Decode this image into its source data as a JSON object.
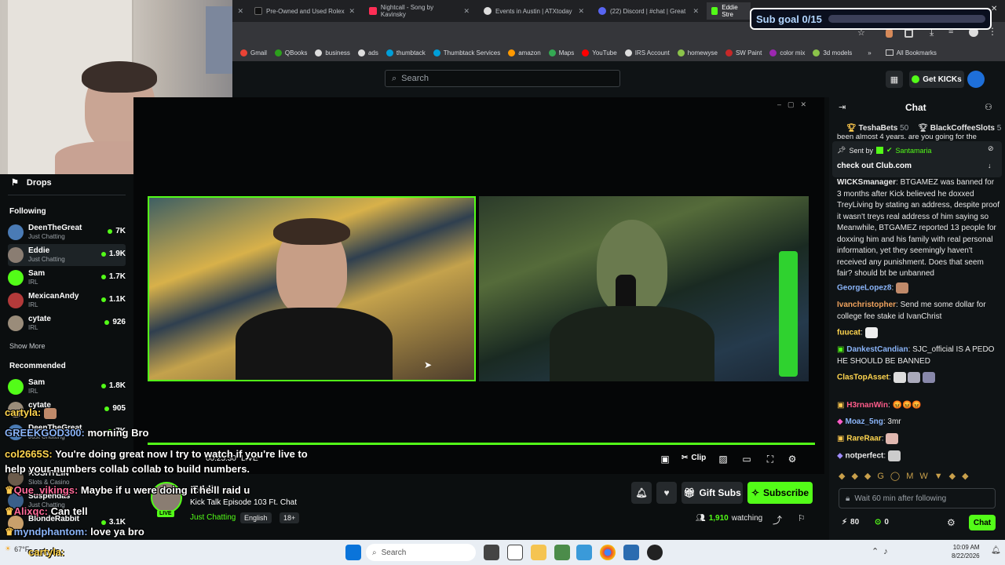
{
  "browser": {
    "tabs": [
      {
        "title": "Pre-Owned and Used Rolex",
        "color": "#111111"
      },
      {
        "title": "Nightcall - Song by Kavinsky",
        "color": "#ff2e55"
      },
      {
        "title": "Events in Austin | ATXtoday",
        "color": "#dddddd"
      },
      {
        "title": "(22) Discord | #chat | Great",
        "color": "#5865f2"
      },
      {
        "title": "Eddie Stre",
        "color": "#53fc18"
      }
    ],
    "bookmarks": [
      {
        "label": "Gmail",
        "color": "#ea4335"
      },
      {
        "label": "QBooks",
        "color": "#2ca01c"
      },
      {
        "label": "business",
        "color": "#dddddd"
      },
      {
        "label": "ads",
        "color": "#dddddd"
      },
      {
        "label": "thumbtack",
        "color": "#009fd9"
      },
      {
        "label": "Thumbtack Services",
        "color": "#009fd9"
      },
      {
        "label": "amazon",
        "color": "#ff9900"
      },
      {
        "label": "Maps",
        "color": "#34a853"
      },
      {
        "label": "YouTube",
        "color": "#ff0000"
      },
      {
        "label": "IRS Account",
        "color": "#dddddd"
      },
      {
        "label": "homewyse",
        "color": "#8bc34a"
      },
      {
        "label": "SW Paint",
        "color": "#c62828"
      },
      {
        "label": "color mix",
        "color": "#9c27b0"
      },
      {
        "label": "3d models",
        "color": "#8bc34a"
      }
    ],
    "all_bookmarks": "All Bookmarks"
  },
  "site": {
    "search_placeholder": "Search",
    "get_kicks": "Get KICKs",
    "accent": "#53fc18"
  },
  "sidebar": {
    "drops": "Drops",
    "following_title": "Following",
    "following": [
      {
        "name": "DeenTheGreat",
        "category": "Just Chatting",
        "viewers": "7K"
      },
      {
        "name": "Eddie",
        "category": "Just Chatting",
        "viewers": "1.9K"
      },
      {
        "name": "Sam",
        "category": "IRL",
        "viewers": "1.7K"
      },
      {
        "name": "MexicanAndy",
        "category": "IRL",
        "viewers": "1.1K"
      },
      {
        "name": "cytate",
        "category": "IRL",
        "viewers": "926"
      }
    ],
    "show_more": "Show More",
    "recommended_title": "Recommended",
    "recommended": [
      {
        "name": "Sam",
        "category": "IRL",
        "viewers": "1.8K"
      },
      {
        "name": "cytate",
        "category": "",
        "viewers": "905"
      },
      {
        "name": "DeenTheGreat",
        "category": "Just Chatting",
        "viewers": "7K"
      },
      {
        "name": "ROSHTEIN",
        "category": "Slots & Casino",
        "viewers": ""
      },
      {
        "name": "Suspendas",
        "category": "Just Chatting",
        "viewers": ""
      },
      {
        "name": "BlondeRabbit",
        "category": "",
        "viewers": "3.1K"
      }
    ]
  },
  "player": {
    "time": "00:25:30",
    "live": "LIVE",
    "clip": "Clip"
  },
  "stream": {
    "channel": "Eddie",
    "title": "Kick Talk Episode 103 Ft. Chat",
    "category": "Just Chatting",
    "tags": [
      "English",
      "18+"
    ],
    "gift_subs": "Gift Subs",
    "subscribe": "Subscribe",
    "watching_count": "1,910",
    "watching_label": "watching",
    "live_badge": "LIVE"
  },
  "chat": {
    "title": "Chat",
    "top_gifters": [
      {
        "name": "TeshaBets",
        "count": "50"
      },
      {
        "name": "BlackCoffeeSlots",
        "count": "5"
      }
    ],
    "partial_top": "been almost 4 years. are you going for the",
    "pinned": {
      "sent_by": "Sent by",
      "user": "Santamaria",
      "message": "check out Club.com"
    },
    "messages": [
      {
        "user": "WICKSmanager",
        "color": "#ffffff",
        "text": "BTGAMEZ was banned for 3 months after Kick believed he doxxed TreyLiving by stating an address, despite proof it wasn't treys real address of him saying so Meanwhile, BTGAMEZ reported 13 people for doxxing him and his family with real personal information, yet they seemingly haven't received any punishment. Does that seem fair? should bt be unbanned"
      },
      {
        "user": "GeorgeLopez8",
        "color": "#8ab4f8",
        "text": ""
      },
      {
        "user": "Ivanchristopher",
        "color": "#f0a35e",
        "text": "Send me some dollar for college fee stake id IvanChrist"
      },
      {
        "user": "fuucat",
        "color": "#ffd54f",
        "text": ""
      },
      {
        "user": "DankestCandian",
        "color": "#8ab4f8",
        "text": "SJC_official IS A PEDO HE SHOULD BE BANNED"
      },
      {
        "user": "ClasTopAsset",
        "color": "#ffd54f",
        "text": ""
      },
      {
        "user": "H3rnanWin",
        "color": "#ff5c8a",
        "text": "😡😡😡"
      },
      {
        "user": "Moaz_5ng",
        "color": "#8ab4f8",
        "text": "3mr"
      },
      {
        "user": "RareRaar",
        "color": "#ffd54f",
        "text": ""
      },
      {
        "user": "notperfect",
        "color": "#ffffff",
        "text": ""
      }
    ],
    "follow_placeholder": "Wait 60 min after following",
    "points": "80",
    "other_count": "0",
    "chat_button": "Chat"
  },
  "overlay": {
    "sub_goal": "Sub goal 0/15",
    "chat_lines": [
      {
        "user": "cartyla:",
        "text": ""
      },
      {
        "user": "GREEKGOD300:",
        "text": "morning Bro"
      },
      {
        "user": "col2665S:",
        "text": "You're doing great now I try to watch if you're live to"
      },
      {
        "user": "",
        "text": "help your numbers collab collab to build numbers."
      },
      {
        "user": "Que_vikings:",
        "text": "Maybe if u were doing it he'll raid u"
      },
      {
        "user": "Alixqc:",
        "text": "Can tell"
      },
      {
        "user": "myndphantom:",
        "text": "love ya bro"
      }
    ],
    "bottom_user": "cartyla:"
  },
  "taskbar": {
    "search": "Search",
    "weather": "67°F",
    "time": "10:09 AM",
    "date": "8/22/2026"
  }
}
